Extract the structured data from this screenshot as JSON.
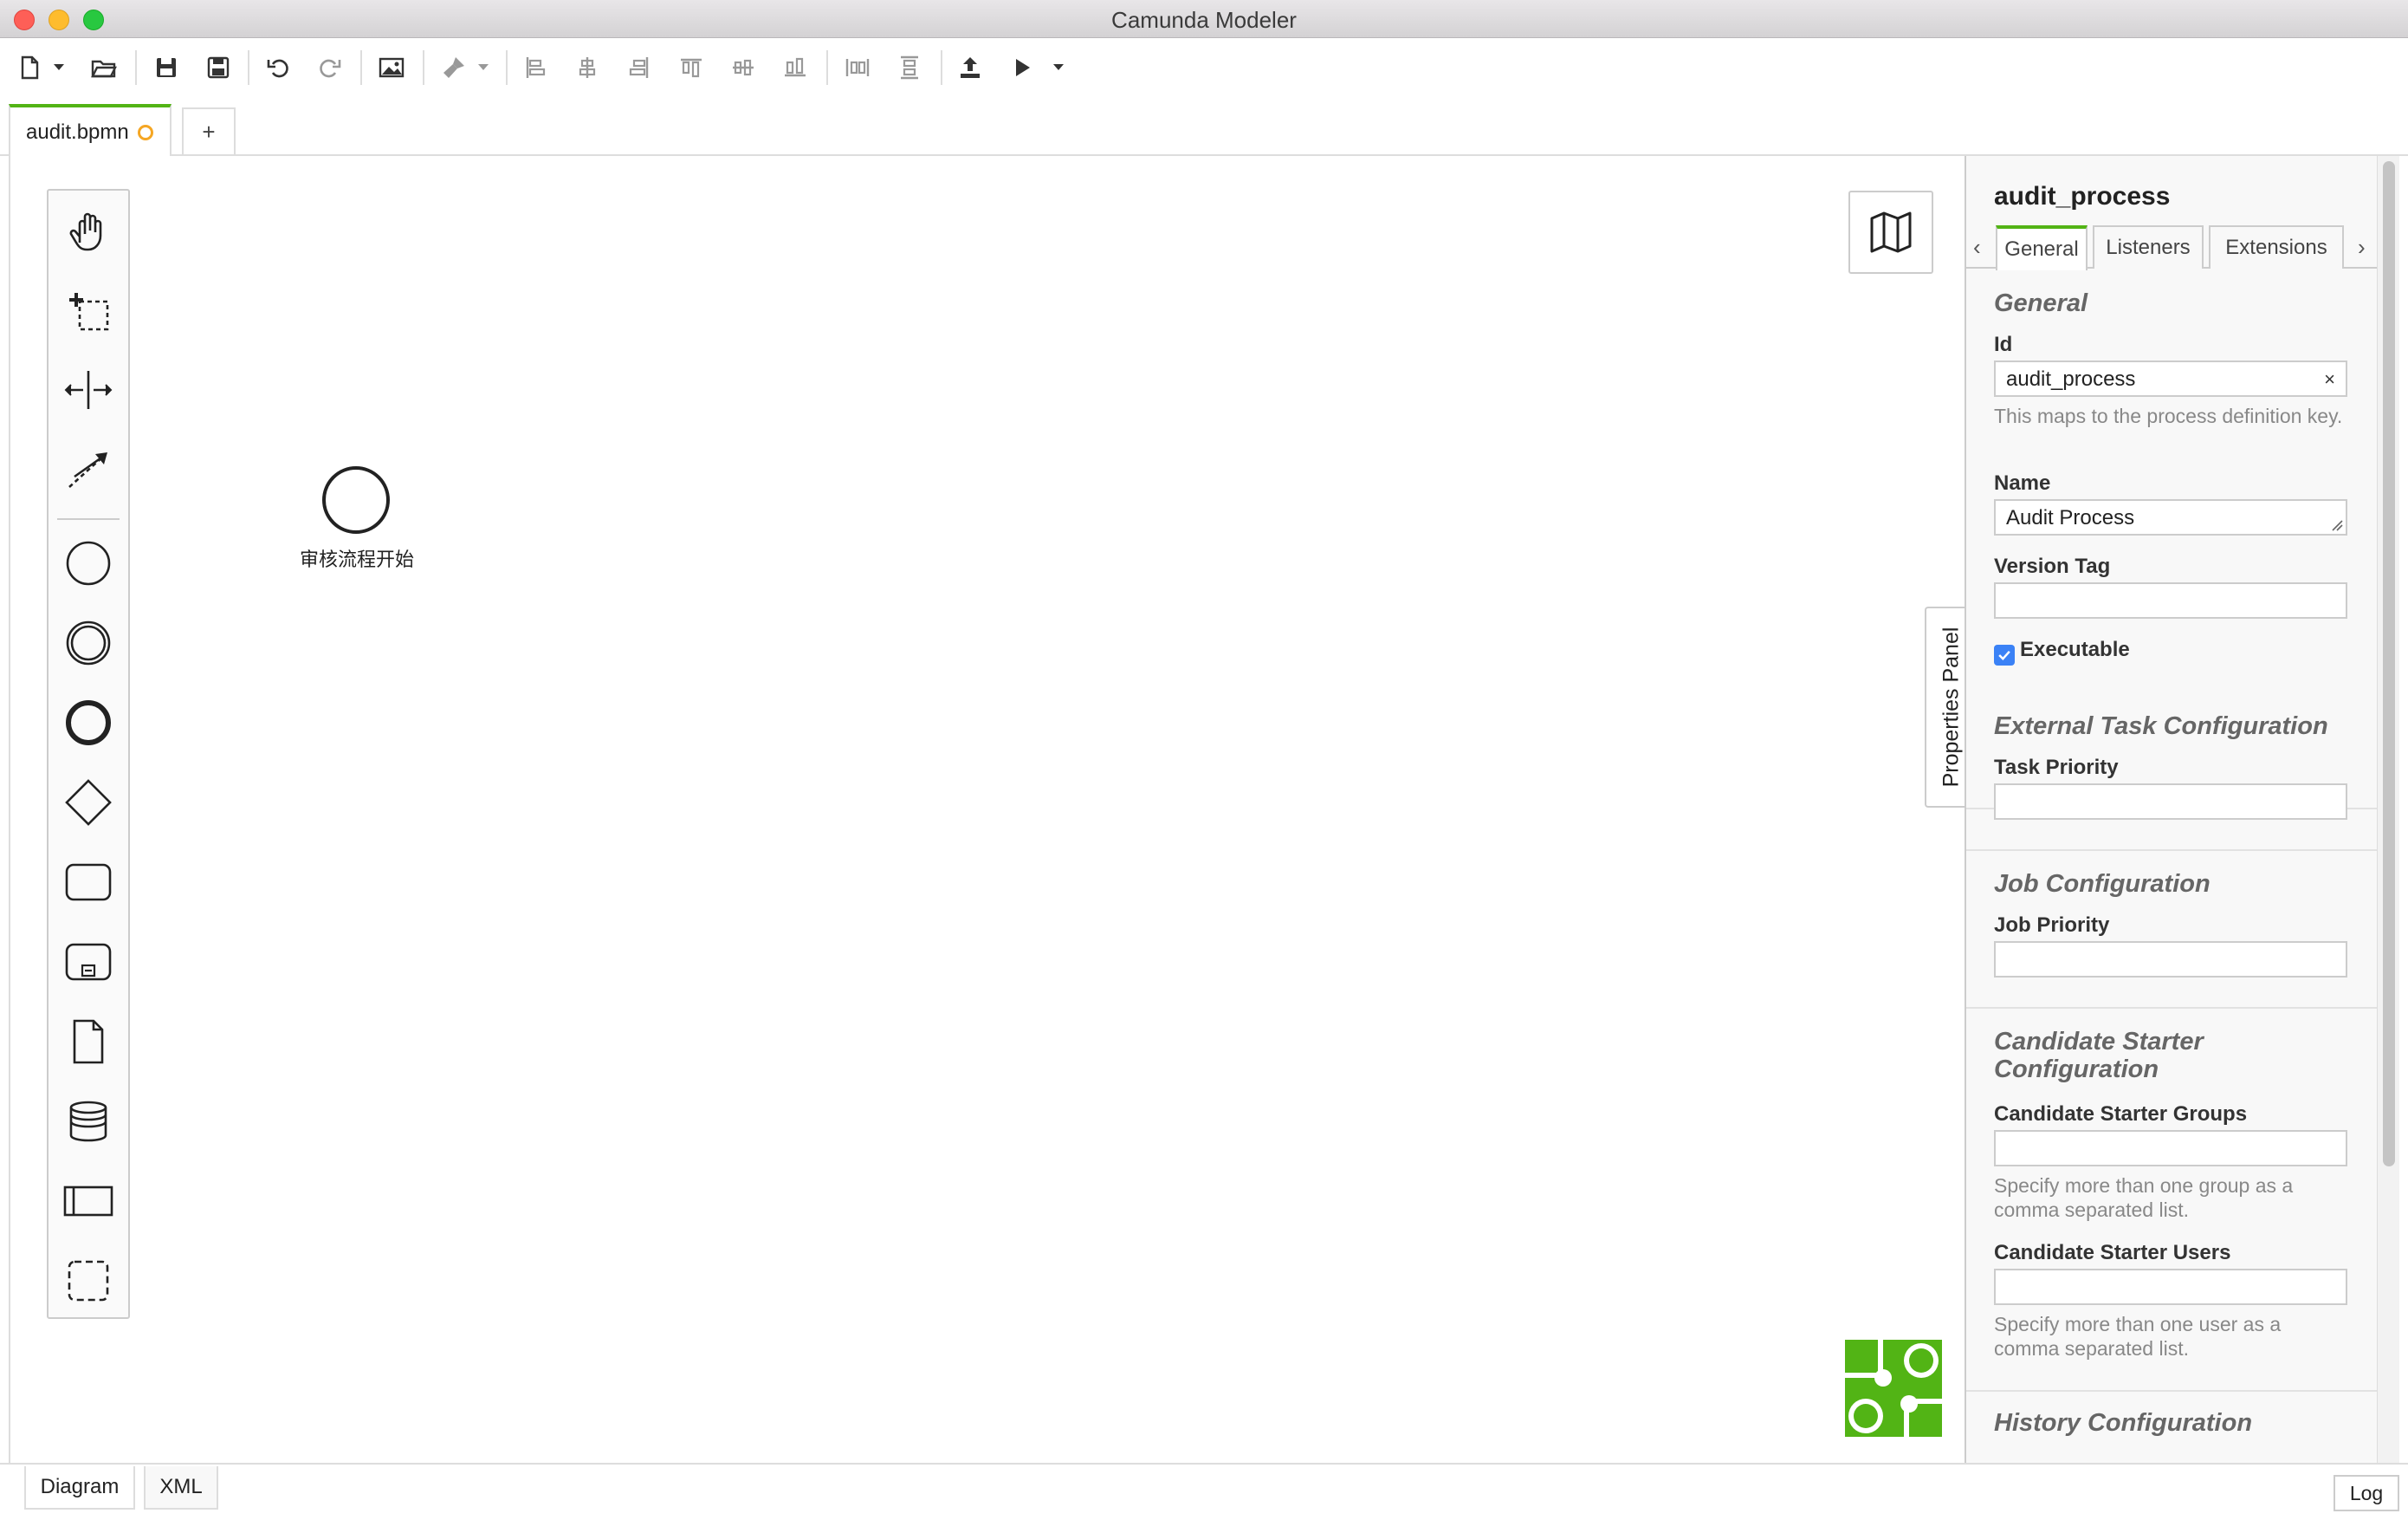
{
  "window": {
    "title": "Camunda Modeler"
  },
  "toolbar": {
    "icons": [
      "new-file-icon",
      "open-icon",
      "save-icon",
      "save-as-icon",
      "undo-icon",
      "redo-icon",
      "export-image-icon",
      "color-picker-icon",
      "align-left-icon",
      "align-center-icon",
      "align-right-icon",
      "align-top-icon",
      "align-middle-icon",
      "align-bottom-icon",
      "distribute-horizontal-icon",
      "distribute-vertical-icon",
      "deploy-icon",
      "start-instance-icon"
    ]
  },
  "tabs": [
    {
      "label": "audit.bpmn",
      "dirty": true
    }
  ],
  "new_tab_label": "+",
  "diagram": {
    "start_event_label": "审核流程开始"
  },
  "properties_toggle_label": "Properties Panel",
  "panel": {
    "title": "audit_process",
    "tabs": [
      "General",
      "Listeners",
      "Extensions"
    ],
    "prev_arrow": "‹",
    "next_arrow": "›",
    "general": {
      "title": "General",
      "id_label": "Id",
      "id_value": "audit_process",
      "id_clear": "×",
      "id_hint": "This maps to the process definition key.",
      "name_label": "Name",
      "name_value": "Audit Process",
      "version_label": "Version Tag",
      "version_value": "",
      "executable_label": "Executable",
      "executable_checked": true
    },
    "external_task": {
      "title": "External Task Configuration",
      "priority_label": "Task Priority",
      "priority_value": ""
    },
    "job": {
      "title": "Job Configuration",
      "priority_label": "Job Priority",
      "priority_value": ""
    },
    "starter": {
      "title": "Candidate Starter Configuration",
      "groups_label": "Candidate Starter Groups",
      "groups_hint": "Specify more than one group as a comma separated list.",
      "users_label": "Candidate Starter Users",
      "users_hint": "Specify more than one user as a comma separated list."
    },
    "history": {
      "title": "History Configuration"
    }
  },
  "bottom_tabs": [
    "Diagram",
    "XML"
  ],
  "log_label": "Log",
  "colors": {
    "accent": "#52b415",
    "checkbox": "#3b82f6",
    "dirty": "#f5a623"
  }
}
